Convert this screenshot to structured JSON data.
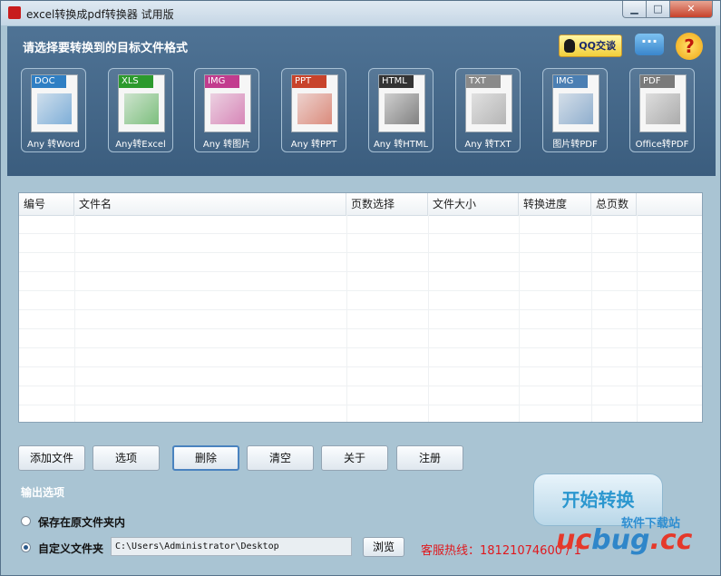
{
  "window": {
    "title": "excel转换成pdf转换器 试用版"
  },
  "header": {
    "title": "请选择要转换到的目标文件格式",
    "qq_label": "QQ交谈"
  },
  "formats": [
    {
      "tag": "DOC",
      "label": "Any 转Word",
      "color": "#2f7fc4",
      "icon": "word-doc-icon"
    },
    {
      "tag": "XLS",
      "label": "Any转Excel",
      "color": "#2c9a2d",
      "icon": "excel-chart-icon"
    },
    {
      "tag": "IMG",
      "label": "Any 转图片",
      "color": "#c23c8e",
      "icon": "image-icon"
    },
    {
      "tag": "PPT",
      "label": "Any 转PPT",
      "color": "#c8432b",
      "icon": "ppt-icon"
    },
    {
      "tag": "HTML",
      "label": "Any 转HTML",
      "color": "#333333",
      "icon": "globe-icon"
    },
    {
      "tag": "TXT",
      "label": "Any 转TXT",
      "color": "#8a8a8a",
      "icon": "text-icon"
    },
    {
      "tag": "IMG",
      "label": "图片转PDF",
      "color": "#4b7fb3",
      "icon": "picture-icon"
    },
    {
      "tag": "PDF",
      "label": "Office转PDF",
      "color": "#7a7a7a",
      "icon": "pdf-check-icon"
    }
  ],
  "table": {
    "columns": [
      "编号",
      "文件名",
      "页数选择",
      "文件大小",
      "转换进度",
      "总页数"
    ]
  },
  "buttons": {
    "add": "添加文件",
    "options": "选项",
    "delete": "删除",
    "clear": "清空",
    "about": "关于",
    "register": "注册"
  },
  "output": {
    "title": "输出选项",
    "keep_original": "保存在原文件夹内",
    "custom_folder": "自定义文件夹",
    "path": "C:\\Users\\Administrator\\Desktop",
    "browse": "浏览"
  },
  "start_button": "开始转换",
  "hotline": "客服热线：18121074600 / 1",
  "watermark": {
    "cn": "软件下载站",
    "en_a": "uc",
    "en_b": "bug",
    "en_c": ".cc"
  }
}
